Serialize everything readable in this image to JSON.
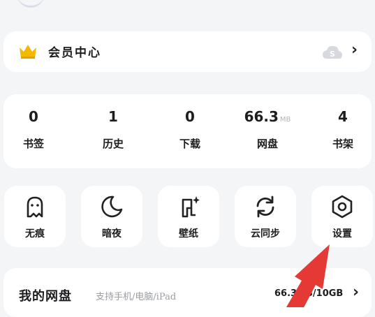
{
  "vip": {
    "label": "会员中心"
  },
  "stats": [
    {
      "value": "0",
      "unit": "",
      "label": "书签"
    },
    {
      "value": "1",
      "unit": "",
      "label": "历史"
    },
    {
      "value": "0",
      "unit": "",
      "label": "下载"
    },
    {
      "value": "66.3",
      "unit": "MB",
      "label": "网盘"
    },
    {
      "value": "4",
      "unit": "",
      "label": "书架"
    }
  ],
  "tools": [
    {
      "label": "无痕",
      "icon": "ghost-icon"
    },
    {
      "label": "暗夜",
      "icon": "moon-icon"
    },
    {
      "label": "壁纸",
      "icon": "wallpaper-icon"
    },
    {
      "label": "云同步",
      "icon": "sync-icon"
    },
    {
      "label": "设置",
      "icon": "settings-hexagon-icon"
    }
  ],
  "disk": {
    "title": "我的网盘",
    "subtitle": "支持手机/电脑/iPad",
    "usage": "66.3MB/10GB"
  },
  "colors": {
    "background": "#f4f5f7",
    "card": "#ffffff",
    "crown": "#f5b800",
    "arrow": "#e53935"
  }
}
